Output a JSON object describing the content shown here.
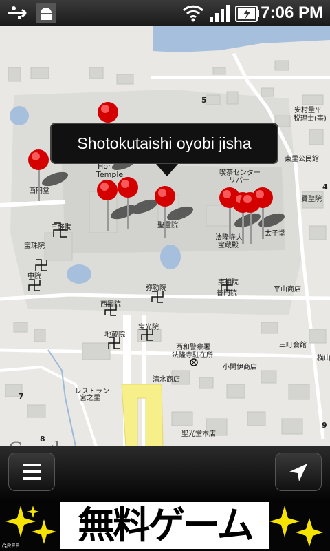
{
  "status_bar": {
    "time": "7:06 PM",
    "icons": [
      "usb-icon",
      "android-debug-icon",
      "wifi-icon",
      "signal-icon",
      "battery-charging-icon"
    ]
  },
  "map": {
    "callout_title": "Shotokutaishi oyobi jisha",
    "attribution": "Google",
    "road_numbers": [
      "5",
      "4",
      "7",
      "8",
      "9"
    ],
    "labels": {
      "yasuda": "安村量平",
      "yasuda2": "税理士(事)",
      "higashisato": "東里公民館",
      "kenseiin": "賢聖院",
      "kissa": "喫茶センター",
      "kissa2": "リバー",
      "nishienin": "西円堂",
      "sankyoin": "三経院",
      "hotei": "宝珠院",
      "chuin": "中院",
      "horyuji1": "法隆寺大",
      "horyuji2": "宝蔵殿",
      "taishiden": "太子堂",
      "yumedono": "聖霊院",
      "mirokuin": "弥勒院",
      "jissoin": "実相院",
      "futamon": "普門院",
      "hirayama": "平山商店",
      "nishienin2": "西園院",
      "hokoin": "宝光院",
      "jizoin": "地蔵院",
      "police1": "西和警察署",
      "police2": "法隆寺駐在所",
      "komon": "小関伊商店",
      "mimachi": "三町会館",
      "yokoyama": "横山",
      "shimizu": "清水商店",
      "restaurant1": "レストラン",
      "restaurant2": "宮之里",
      "seikodo": "聖光堂本店",
      "hotel": "Hor",
      "temple": "Temple"
    }
  },
  "toolbar": {
    "menu_icon": "list-menu-icon",
    "location_icon": "navigation-arrow-icon"
  },
  "ad": {
    "text": "無料ゲーム",
    "brand": "GREE"
  },
  "colors": {
    "map_bg": "#ededea",
    "water": "#a5bfdd",
    "pin_red": "#e01010",
    "road_yellow": "#f7ef8a"
  }
}
